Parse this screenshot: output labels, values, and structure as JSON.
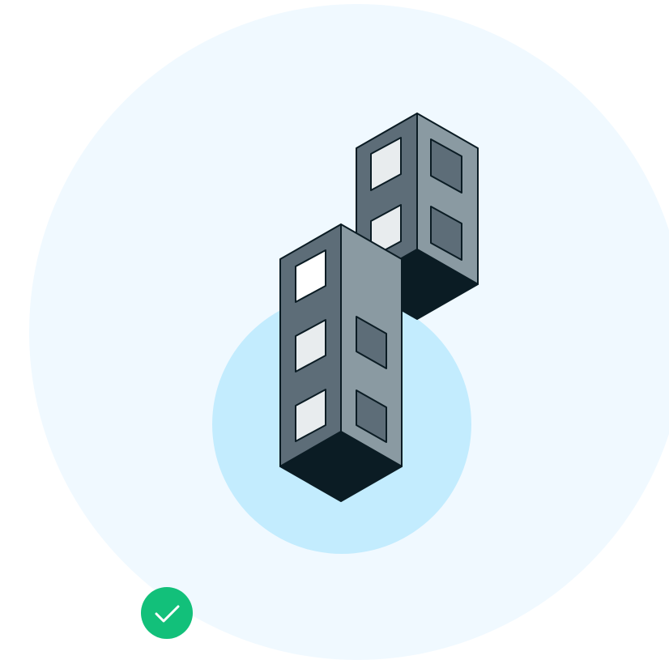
{
  "colors": {
    "page_background": "#ffffff",
    "outer_circle": "#f0f9ff",
    "inner_circle": "#c3ecfe",
    "building_left_face": "#5d6d78",
    "building_right_face": "#8a9aa2",
    "building_base": "#0b1c24",
    "window_light": "#e8ecee",
    "window_lit": "#ffffff",
    "window_dark": "#5d6d78",
    "outline": "#0b1c24",
    "check_badge": "#12c07a",
    "check_mark": "#ffffff"
  },
  "illustration": {
    "subject": "two-isometric-buildings",
    "badge_icon": "check-icon"
  }
}
